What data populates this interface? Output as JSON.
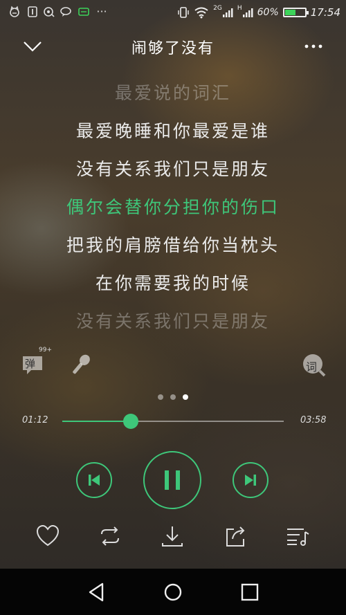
{
  "status_bar": {
    "network": "2G",
    "network2": "H",
    "battery": "60%",
    "battery_level": 0.6,
    "time": "17:54",
    "more": "···"
  },
  "header": {
    "title": "闹够了没有"
  },
  "lyrics": [
    {
      "text": "最爱说的词汇",
      "state": "dim"
    },
    {
      "text": "最爱晚睡和你最爱是谁",
      "state": "normal"
    },
    {
      "text": "没有关系我们只是朋友",
      "state": "normal"
    },
    {
      "text": "偶尔会替你分担你的伤口",
      "state": "active"
    },
    {
      "text": "把我的肩膀借给你当枕头",
      "state": "normal"
    },
    {
      "text": "在你需要我的时候",
      "state": "normal"
    },
    {
      "text": "没有关系我们只是朋友",
      "state": "dim"
    }
  ],
  "tools": {
    "danmu_label": "弹",
    "danmu_badge": "99+",
    "lyrics_label": "词"
  },
  "pager": {
    "count": 3,
    "active": 2
  },
  "progress": {
    "current": "01:12",
    "total": "03:58",
    "fraction": 0.31
  },
  "colors": {
    "accent": "#3ec77a"
  }
}
